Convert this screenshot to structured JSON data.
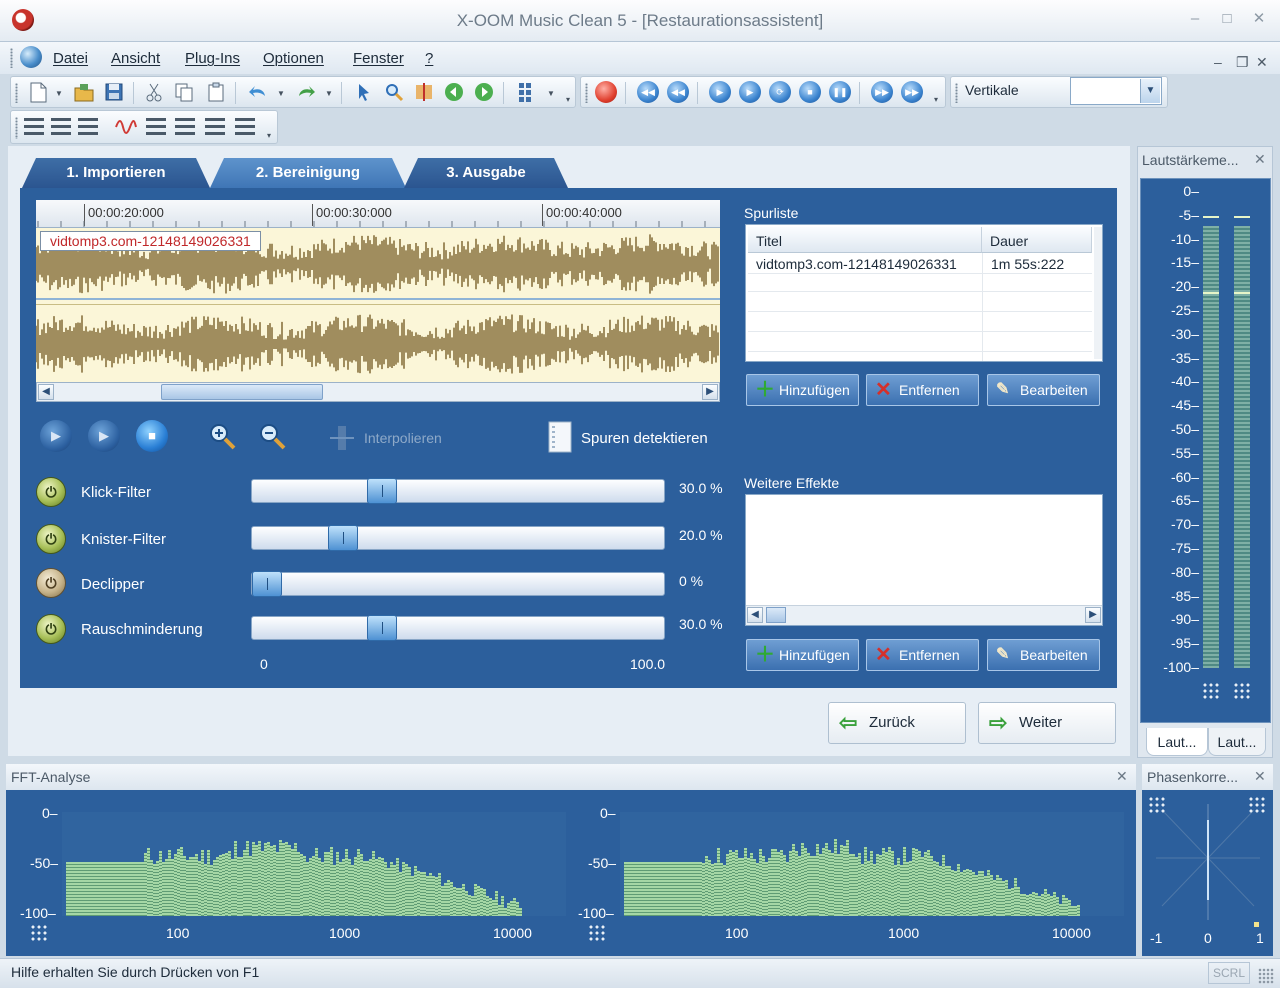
{
  "window": {
    "title": "X-OOM Music Clean 5 - [Restaurationsassistent]",
    "min_glyph": "–",
    "max_glyph": "□",
    "close_glyph": "✕"
  },
  "menu": {
    "items": [
      "Datei",
      "Ansicht",
      "Plug-Ins",
      "Optionen",
      "Fenster",
      "?"
    ]
  },
  "toolbar": {
    "vertical_label": "Vertikale",
    "vertical_value": ""
  },
  "tabs": [
    {
      "label": "1. Importieren",
      "active": false
    },
    {
      "label": "2. Bereinigung",
      "active": true
    },
    {
      "label": "3. Ausgabe",
      "active": false
    }
  ],
  "timeline": {
    "markers": [
      "00:00:20:000",
      "00:00:30:000",
      "00:00:40:000"
    ]
  },
  "waveform": {
    "track_name": "vidtomp3.com-12148149026331",
    "color": "#8a7340",
    "background": "#fbf6d8"
  },
  "transport": {
    "interpolate_label": "Interpolieren",
    "detect_tracks_label": "Spuren detektieren"
  },
  "filters": [
    {
      "label": "Klick-Filter",
      "value": 30.0,
      "value_text": "30.0 %",
      "enabled": true
    },
    {
      "label": "Knister-Filter",
      "value": 20.0,
      "value_text": "20.0 %",
      "enabled": true
    },
    {
      "label": "Declipper",
      "value": 0,
      "value_text": "0 %",
      "enabled": false
    },
    {
      "label": "Rauschminderung",
      "value": 30.0,
      "value_text": "30.0 %",
      "enabled": true
    }
  ],
  "slider_scale": {
    "min_label": "0",
    "max_label": "100.0"
  },
  "track_list": {
    "caption": "Spurliste",
    "columns": [
      "Titel",
      "Dauer"
    ],
    "rows": [
      {
        "title": "vidtomp3.com-12148149026331",
        "duration": "1m 55s:222"
      }
    ]
  },
  "track_buttons": {
    "add": "Hinzufügen",
    "remove": "Entfernen",
    "edit": "Bearbeiten"
  },
  "effects": {
    "caption": "Weitere Effekte",
    "add": "Hinzufügen",
    "remove": "Entfernen",
    "edit": "Bearbeiten"
  },
  "nav": {
    "back": "Zurück",
    "next": "Weiter"
  },
  "level_meter": {
    "title": "Lautstärkeme...",
    "db_labels": [
      "0–",
      "-5–",
      "-10–",
      "-15–",
      "-20–",
      "-25–",
      "-30–",
      "-35–",
      "-40–",
      "-45–",
      "-50–",
      "-55–",
      "-60–",
      "-65–",
      "-70–",
      "-75–",
      "-80–",
      "-85–",
      "-90–",
      "-95–",
      "-100–"
    ],
    "tabs": [
      "Laut...",
      "Laut..."
    ]
  },
  "fft": {
    "title": "FFT-Analyse",
    "y_labels": [
      "0–",
      "-50–",
      "-100–"
    ],
    "x_labels": [
      "100",
      "1000",
      "10000"
    ]
  },
  "phase": {
    "title": "Phasenkorre...",
    "x_labels": [
      "-1",
      "0",
      "1"
    ]
  },
  "status": {
    "text": "Hilfe erhalten Sie durch Drücken von F1",
    "scrl": "SCRL"
  }
}
